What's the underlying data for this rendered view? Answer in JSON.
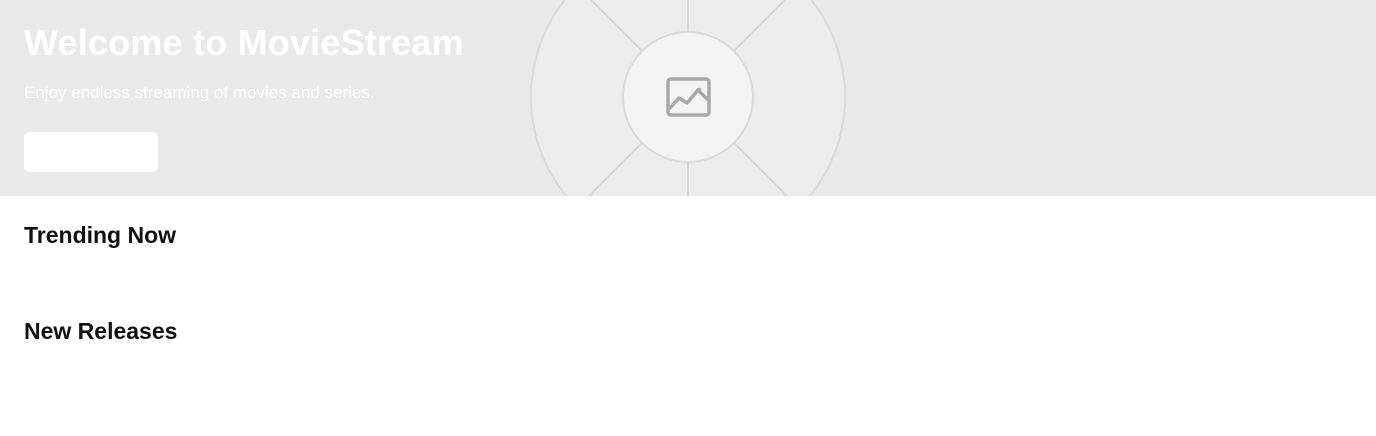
{
  "hero": {
    "title": "Welcome to MovieStream",
    "subtitle": "Enjoy endless streaming of movies and series.",
    "cta_label": "",
    "background_color": "#e9e9e9",
    "image_placeholder_icon": "image-placeholder-icon"
  },
  "sections": {
    "trending": {
      "title": "Trending Now"
    },
    "new_releases": {
      "title": "New Releases"
    }
  },
  "colors": {
    "hero_text": "#ffffff",
    "heading_text": "#111111",
    "page_background": "#ffffff",
    "placeholder_stroke": "#d6d6d6",
    "placeholder_icon": "#a8a8a8"
  }
}
